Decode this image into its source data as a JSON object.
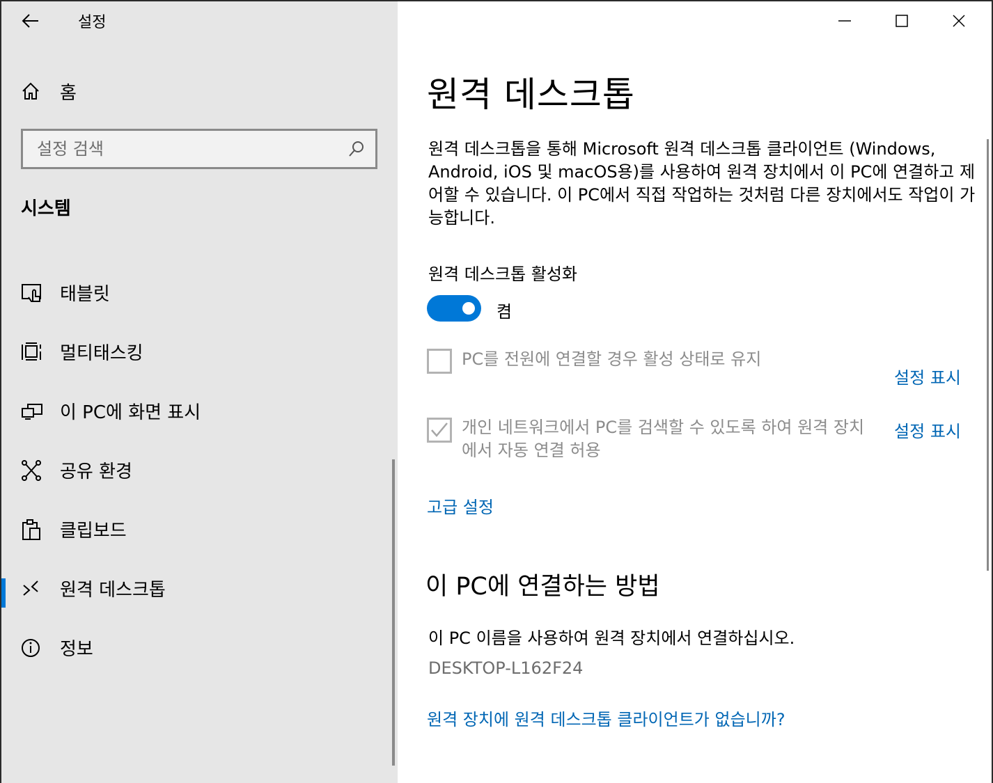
{
  "app": {
    "title": "설정"
  },
  "sidebar": {
    "home_label": "홈",
    "search_placeholder": "설정 검색",
    "section_title": "시스템",
    "items": [
      {
        "label": "태블릿",
        "icon": "tablet-icon"
      },
      {
        "label": "멀티태스킹",
        "icon": "multitasking-icon"
      },
      {
        "label": "이 PC에 화면 표시",
        "icon": "project-icon"
      },
      {
        "label": "공유 환경",
        "icon": "shared-experiences-icon"
      },
      {
        "label": "클립보드",
        "icon": "clipboard-icon"
      },
      {
        "label": "원격 데스크톱",
        "icon": "remote-desktop-icon",
        "selected": true
      },
      {
        "label": "정보",
        "icon": "info-icon"
      }
    ]
  },
  "main": {
    "title": "원격 데스크톱",
    "description": "원격 데스크톱을 통해 Microsoft 원격 데스크톱 클라이언트 (Windows, Android, iOS 및 macOS용)를 사용하여 원격 장치에서 이 PC에 연결하고 제어할 수 있습니다. 이 PC에서 직접 작업하는 것처럼 다른 장치에서도 작업이 가능합니다.",
    "enable_label": "원격 데스크톱 활성화",
    "toggle_state": "켬",
    "toggle_on": true,
    "option1": {
      "label": "PC를 전원에 연결할 경우 활성 상태로 유지",
      "checked": false,
      "link": "설정 표시"
    },
    "option2": {
      "label": "개인 네트워크에서 PC를 검색할 수 있도록 하여 원격 장치에서 자동 연결 허용",
      "checked": true,
      "link": "설정 표시"
    },
    "advanced_link": "고급 설정",
    "howto_title": "이 PC에 연결하는 방법",
    "howto_text": "이 PC 이름을 사용하여 원격 장치에서 연결하십시오.",
    "pc_name": "DESKTOP-L162F24",
    "no_client_link": "원격 장치에 원격 데스크톱 클라이언트가 없습니까?"
  },
  "colors": {
    "accent": "#0078d7",
    "link": "#0066b4",
    "sidebar_bg": "#e6e6e6",
    "disabled_text": "#8c8c8c"
  }
}
